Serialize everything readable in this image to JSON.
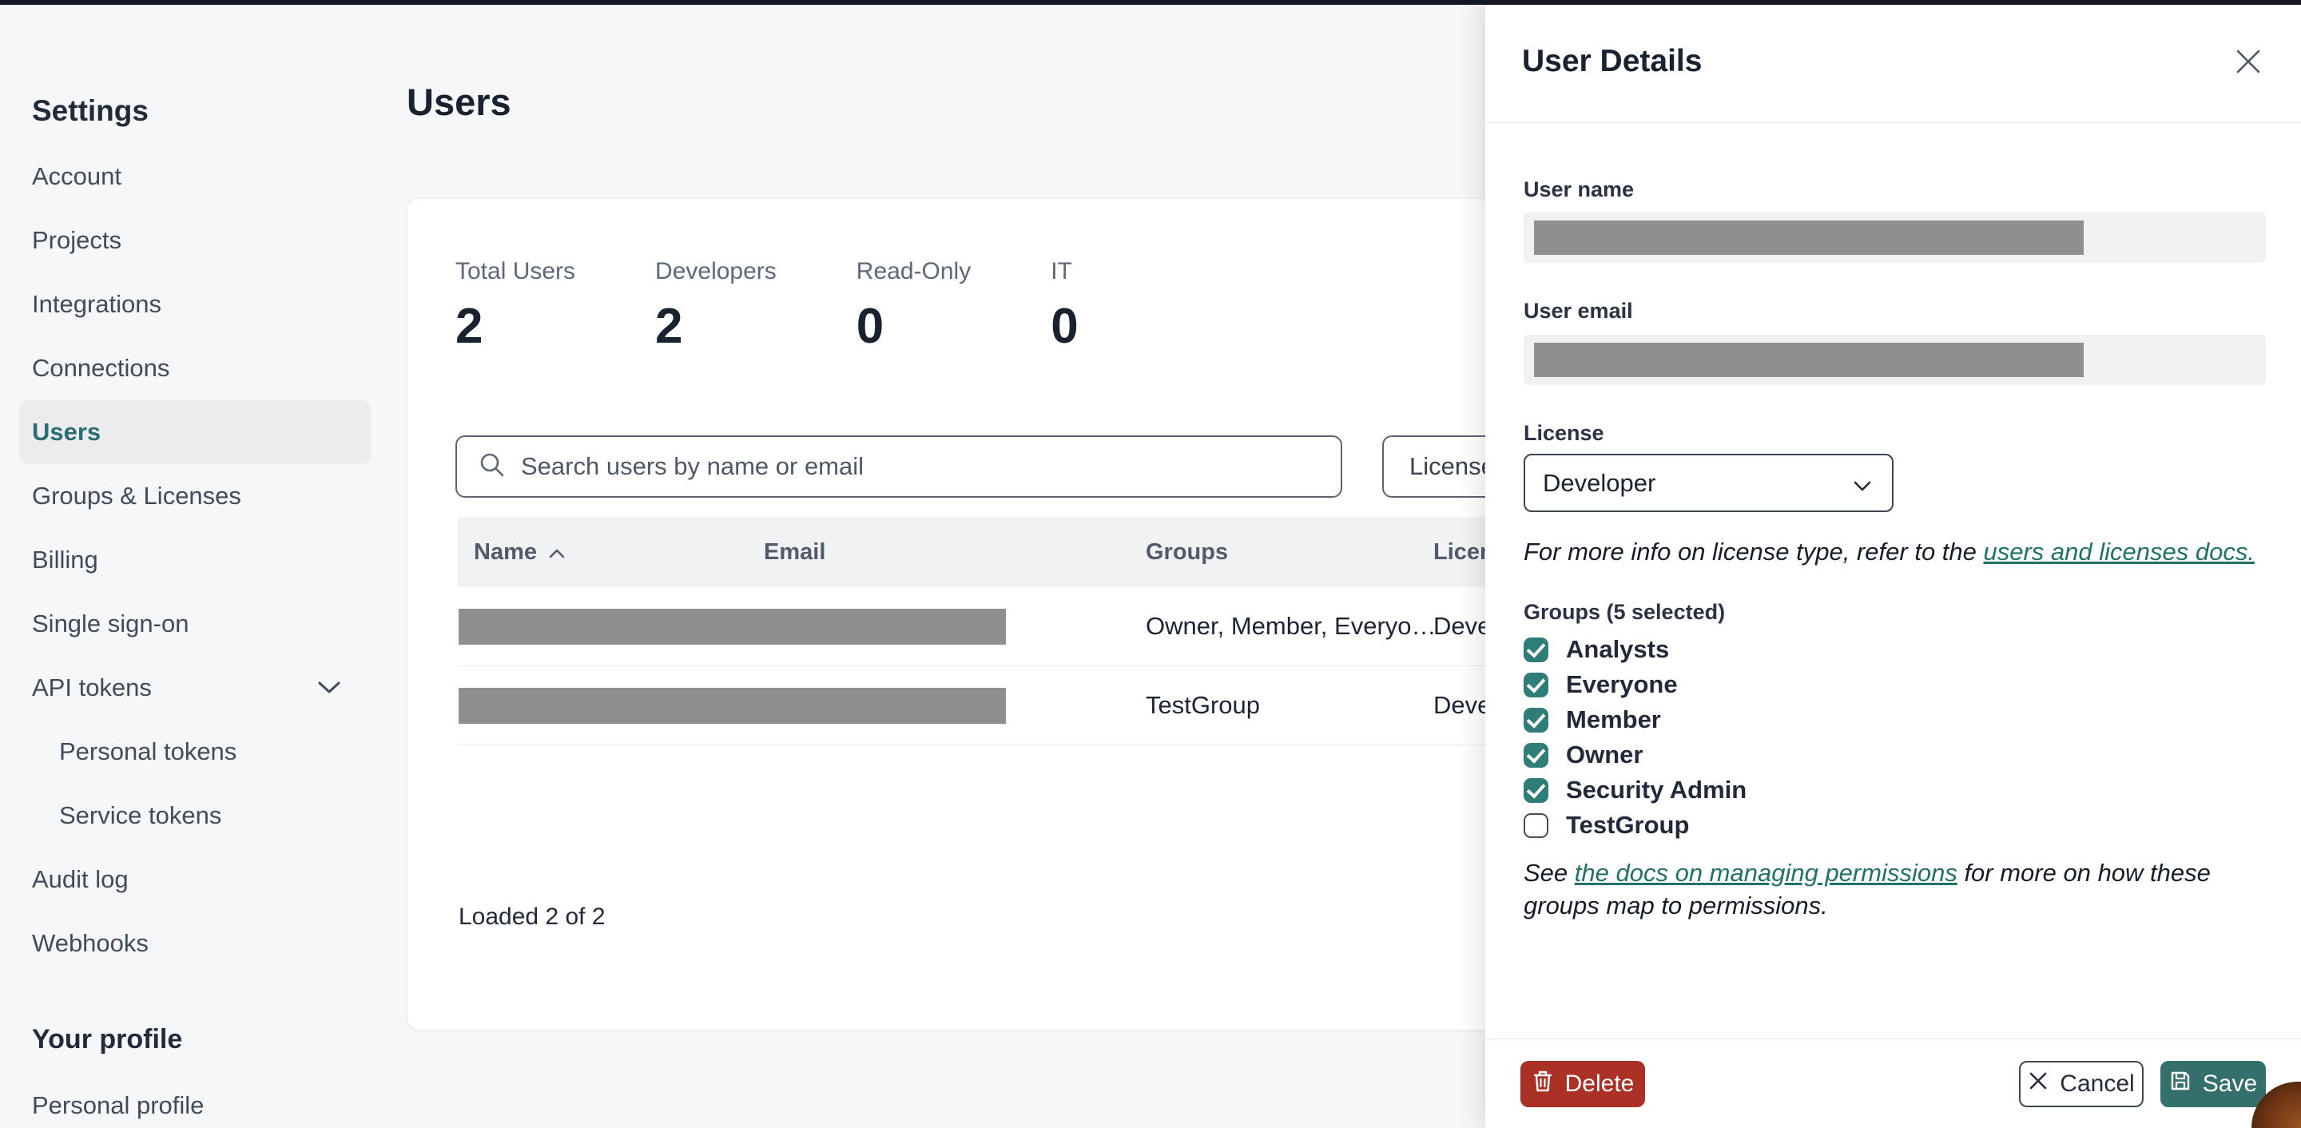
{
  "colors": {
    "top_bar": "#141822",
    "page_background": "#f6f7f8",
    "card_background": "#ffffff",
    "accent_teal": "#2b6d73",
    "checkbox_teal": "#2f7d78",
    "link_teal": "#1f7265",
    "delete_red": "#ab3126",
    "save_teal": "#356f6b",
    "redaction_gray": "#8f8f8f",
    "table_header_bg": "#f1f2f4"
  },
  "sidebar": {
    "section_title": "Settings",
    "items": [
      {
        "label": "Account"
      },
      {
        "label": "Projects"
      },
      {
        "label": "Integrations"
      },
      {
        "label": "Connections"
      },
      {
        "label": "Users",
        "active": true
      },
      {
        "label": "Groups & Licenses"
      },
      {
        "label": "Billing"
      },
      {
        "label": "Single sign-on"
      },
      {
        "label": "API tokens",
        "chevron": "collapsed-down"
      },
      {
        "label": "Personal tokens",
        "indent": true
      },
      {
        "label": "Service tokens",
        "indent": true
      },
      {
        "label": "Audit log"
      },
      {
        "label": "Webhooks"
      }
    ],
    "profile_section_title": "Your profile",
    "profile_items": [
      {
        "label": "Personal profile"
      }
    ]
  },
  "main": {
    "page_title": "Users",
    "stats": [
      {
        "label": "Total Users",
        "value": "2"
      },
      {
        "label": "Developers",
        "value": "2"
      },
      {
        "label": "Read-Only",
        "value": "0"
      },
      {
        "label": "IT",
        "value": "0"
      }
    ],
    "search": {
      "placeholder": "Search users by name or email"
    },
    "license_filter_label": "License",
    "table": {
      "columns": [
        "Name",
        "Email",
        "Groups",
        "License"
      ],
      "sort": {
        "column": "Name",
        "direction": "ascending"
      },
      "rows": [
        {
          "name": "(redacted)",
          "email": "(redacted)",
          "groups": "Owner, Member, Everyo…",
          "license": "Developer"
        },
        {
          "name": "(redacted)",
          "email": "(redacted)",
          "groups": "TestGroup",
          "license": "Developer"
        }
      ],
      "footer_status": "Loaded 2 of 2"
    }
  },
  "panel": {
    "title": "User Details",
    "user_name_label": "User name",
    "user_name_value": "(redacted)",
    "user_email_label": "User email",
    "user_email_value": "(redacted)",
    "license_label": "License",
    "license_value": "Developer",
    "license_note_prefix": "For more info on license type, refer to the ",
    "license_note_link": "users and licenses docs.",
    "groups_label": "Groups (5 selected)",
    "groups": [
      {
        "label": "Analysts",
        "checked": true
      },
      {
        "label": "Everyone",
        "checked": true
      },
      {
        "label": "Member",
        "checked": true
      },
      {
        "label": "Owner",
        "checked": true
      },
      {
        "label": "Security Admin",
        "checked": true
      },
      {
        "label": "TestGroup",
        "checked": false
      }
    ],
    "permissions_note_prefix": "See ",
    "permissions_note_link": "the docs on managing permissions",
    "permissions_note_suffix": " for more on how these groups map to permissions.",
    "footer": {
      "delete_label": "Delete",
      "cancel_label": "Cancel",
      "save_label": "Save"
    }
  }
}
